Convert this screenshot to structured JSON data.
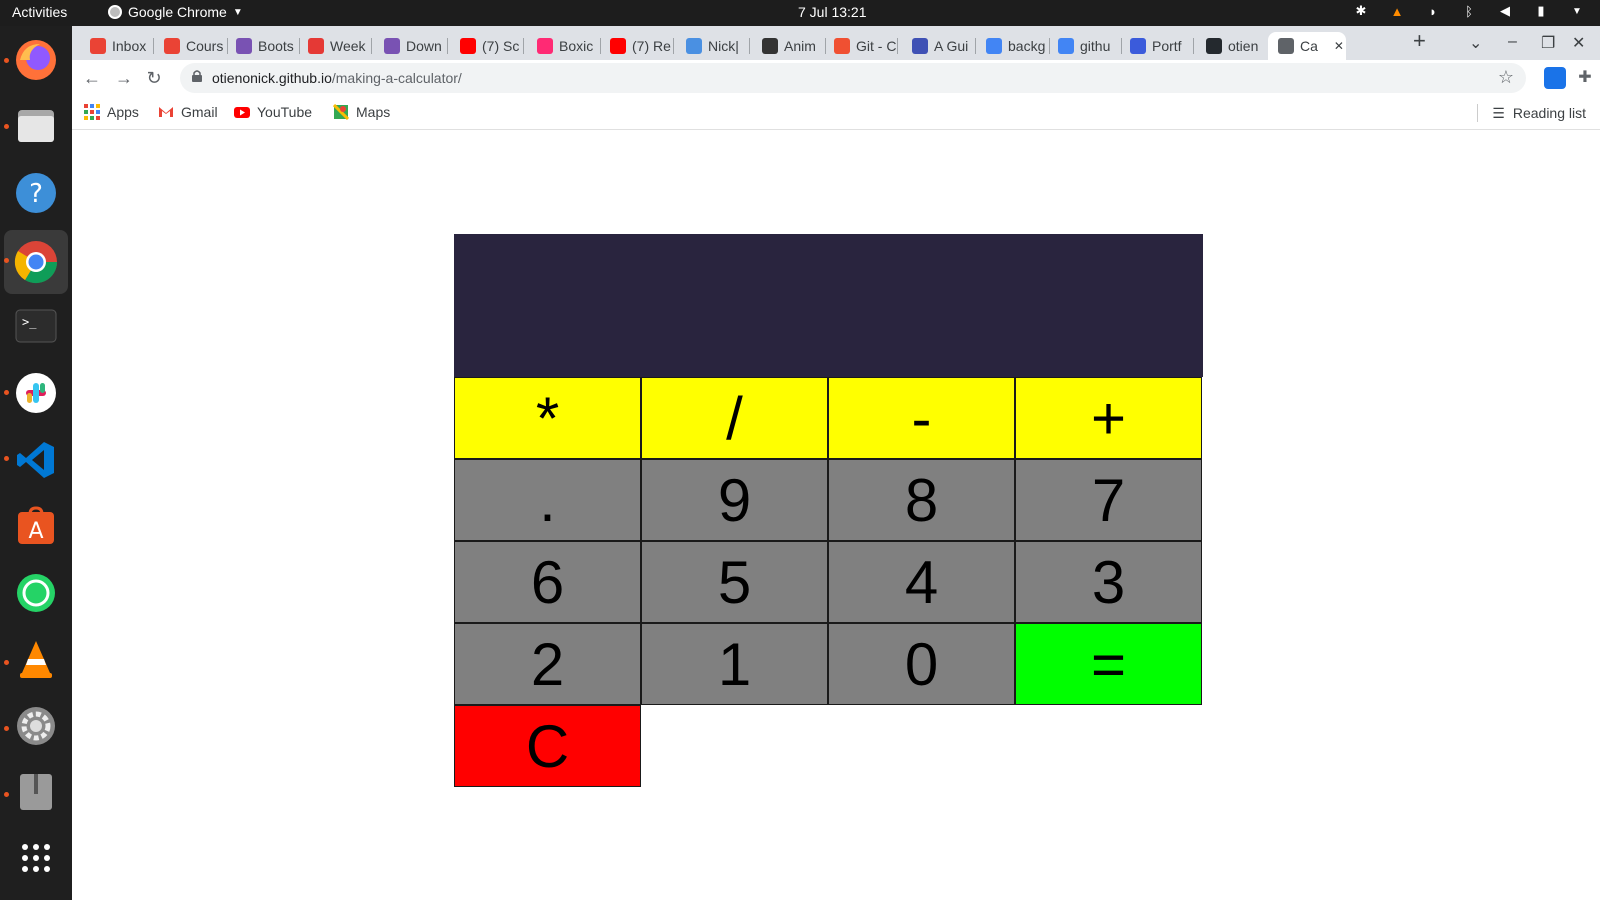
{
  "system": {
    "activities_label": "Activities",
    "app_name": "Google Chrome",
    "clock": "7 Jul  13:21"
  },
  "browser": {
    "tabs": [
      {
        "label": "Inbox",
        "icon": "gmail-icon",
        "color": "#ea4335"
      },
      {
        "label": "Cours",
        "icon": "gmail-icon",
        "color": "#ea4335"
      },
      {
        "label": "Boots",
        "icon": "bootstrap-icon",
        "color": "#7952b3"
      },
      {
        "label": "Week",
        "icon": "dotted-circle-icon",
        "color": "#e53935"
      },
      {
        "label": "Down",
        "icon": "bootstrap-icon",
        "color": "#7952b3"
      },
      {
        "label": "(7) Sc",
        "icon": "youtube-icon",
        "color": "#ff0000"
      },
      {
        "label": "Boxic",
        "icon": "boxicons-icon",
        "color": "#ff2a74"
      },
      {
        "label": "(7) Re",
        "icon": "youtube-icon",
        "color": "#ff0000"
      },
      {
        "label": "Nick|",
        "icon": "site-icon",
        "color": "#4a90e2"
      },
      {
        "label": "Anim",
        "icon": "site-icon",
        "color": "#333333"
      },
      {
        "label": "Git - C",
        "icon": "git-icon",
        "color": "#f05032"
      },
      {
        "label": "A Gui",
        "icon": "fx-icon",
        "color": "#3f51b5"
      },
      {
        "label": "backg",
        "icon": "google-icon",
        "color": "#4285f4"
      },
      {
        "label": "githu",
        "icon": "google-icon",
        "color": "#4285f4"
      },
      {
        "label": "Portf",
        "icon": "site-icon",
        "color": "#3b5bdb"
      },
      {
        "label": "otien",
        "icon": "github-icon",
        "color": "#24292e"
      },
      {
        "label": "Ca",
        "icon": "globe-icon",
        "color": "#5f6368",
        "active": true
      }
    ],
    "url_host": "otienonick.github.io",
    "url_path": "/making-a-calculator/",
    "bookmarks": [
      {
        "label": "Apps",
        "icon": "apps-grid-icon"
      },
      {
        "label": "Gmail",
        "icon": "gmail-icon"
      },
      {
        "label": "YouTube",
        "icon": "youtube-icon"
      },
      {
        "label": "Maps",
        "icon": "maps-icon"
      }
    ],
    "reading_list_label": "Reading list"
  },
  "calculator": {
    "display": "",
    "colors": {
      "display_bg": "#29243e",
      "operator": "#ffff00",
      "number": "#808080",
      "equals": "#00ff00",
      "clear": "#ff0000"
    },
    "rows": [
      [
        {
          "label": "*",
          "type": "op"
        },
        {
          "label": "/",
          "type": "op"
        },
        {
          "label": "-",
          "type": "op"
        },
        {
          "label": "+",
          "type": "op"
        }
      ],
      [
        {
          "label": ".",
          "type": "num"
        },
        {
          "label": "9",
          "type": "num"
        },
        {
          "label": "8",
          "type": "num"
        },
        {
          "label": "7",
          "type": "num"
        }
      ],
      [
        {
          "label": "6",
          "type": "num"
        },
        {
          "label": "5",
          "type": "num"
        },
        {
          "label": "4",
          "type": "num"
        },
        {
          "label": "3",
          "type": "num"
        }
      ],
      [
        {
          "label": "2",
          "type": "num"
        },
        {
          "label": "1",
          "type": "num"
        },
        {
          "label": "0",
          "type": "num"
        },
        {
          "label": "=",
          "type": "eq"
        }
      ],
      [
        {
          "label": "C",
          "type": "clear"
        }
      ]
    ]
  }
}
